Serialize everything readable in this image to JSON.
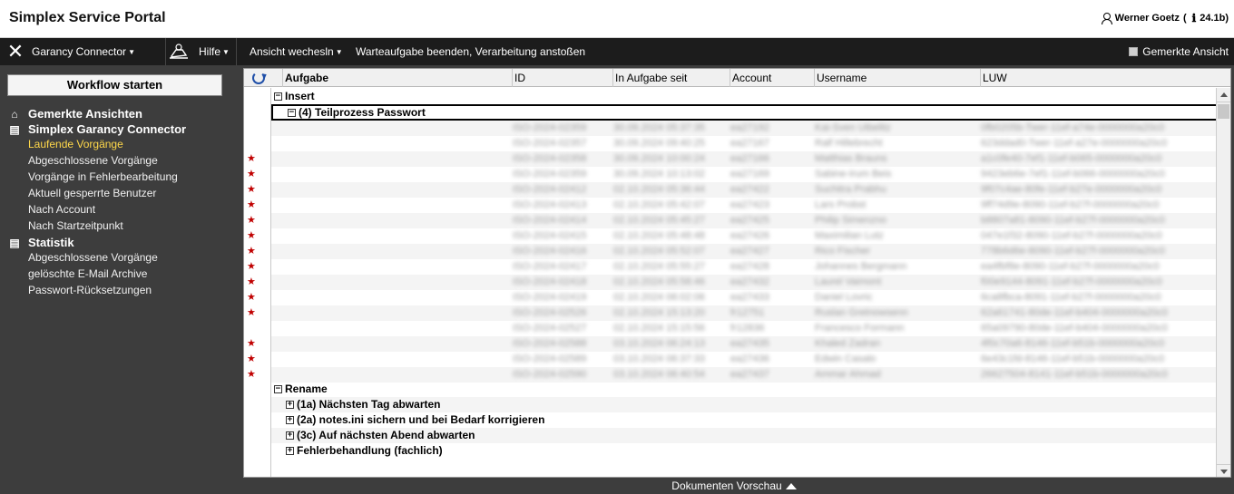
{
  "app": {
    "title": "Simplex Service Portal",
    "user": "Werner Goetz",
    "user_suffix": "(",
    "version": "24.1b)"
  },
  "toolbar": {
    "connector": "Garancy Connector",
    "hilfe": "Hilfe",
    "ansicht": "Ansicht wechesln",
    "warteaufgabe": "Warteaufgabe beenden, Verarbeitung anstoßen",
    "gemerkte_ansicht": "Gemerkte Ansicht"
  },
  "sidebar": {
    "workflow_button": "Workflow starten",
    "section_gemerkte": "Gemerkte Ansichten",
    "section_connector": "Simplex Garancy Connector",
    "connector_items": [
      "Laufende Vorgänge",
      "Abgeschlossene Vorgänge",
      "Vorgänge in Fehlerbearbeitung",
      "Aktuell gesperrte Benutzer",
      "Nach Account",
      "Nach Startzeitpunkt"
    ],
    "section_statistik": "Statistik",
    "statistik_items": [
      "Abgeschlossene Vorgänge",
      "gelöschte E-Mail Archive",
      "Passwort-Rücksetzungen"
    ]
  },
  "grid": {
    "columns": [
      "Aufgabe",
      "ID",
      "In Aufgabe seit",
      "Account",
      "Username",
      "LUW"
    ],
    "groups": {
      "insert": "Insert",
      "teilprozess": "(4) Teilprozess Passwort",
      "rename": "Rename",
      "rename_children": [
        "(1a) Nächsten Tag abwarten",
        "(2a) notes.ini sichern und bei Bedarf korrigieren",
        "(3c) Auf nächsten Abend abwarten",
        "Fehlerbehandlung (fachlich)"
      ]
    },
    "rows": [
      {
        "id": "ISO-2024-02359",
        "since": "30.09.2024 05:37:35",
        "account": "ea27192",
        "username": "Kai-Sven Uibelitz",
        "luw": "0fb0205b-Twer-11ef-a74e-0000000a20c0",
        "star": false
      },
      {
        "id": "ISO-2024-02357",
        "since": "30.09.2024 09:40:25",
        "account": "ea27167",
        "username": "Ralf Hillebrecht",
        "luw": "623ddad0-Twer-11ef-a27e-0000000a20c0",
        "star": false
      },
      {
        "id": "ISO-2024-02358",
        "since": "30.09.2024 10:00:24",
        "account": "ea27166",
        "username": "Matthias Brauns",
        "luw": "a1c0fe40-7ef1-11ef-b065-0000000a20c0",
        "star": true
      },
      {
        "id": "ISO-2024-02359",
        "since": "30.09.2024 10:13:02",
        "account": "ea27169",
        "username": "Sabine-Irum Beis",
        "luw": "9423eb6e-7ef1-11ef-b066-0000000a20c0",
        "star": true
      },
      {
        "id": "ISO-2024-02412",
        "since": "02.10.2024 05:36:44",
        "account": "ea27422",
        "username": "Suchitra Prabhu",
        "luw": "9f07c4ae-80fe-11ef-b27e-0000000a20c0",
        "star": true
      },
      {
        "id": "ISO-2024-02413",
        "since": "02.10.2024 05:42:07",
        "account": "ea27423",
        "username": "Lars Probst",
        "luw": "9ff74d9e-8090-11ef-b27f-0000000a20c0",
        "star": true
      },
      {
        "id": "ISO-2024-02414",
        "since": "02.10.2024 05:45:27",
        "account": "ea27425",
        "username": "Philip Simenzno",
        "luw": "b8807a81-8090-11ef-b27f-0000000a20c0",
        "star": true
      },
      {
        "id": "ISO-2024-02415",
        "since": "02.10.2024 05:48:48",
        "account": "ea27426",
        "username": "Maximilian Lutz",
        "luw": "047e1f32-8090-11ef-b27f-0000000a20c0",
        "star": true
      },
      {
        "id": "ISO-2024-02416",
        "since": "02.10.2024 05:52:07",
        "account": "ea27427",
        "username": "Rico Fischer",
        "luw": "778b6d6e-8090-11ef-b27f-0000000a20c0",
        "star": true
      },
      {
        "id": "ISO-2024-02417",
        "since": "02.10.2024 05:55:27",
        "account": "ea27428",
        "username": "Johannes Bergmann",
        "luw": "ea4fbf8e-8090-11ef-b27f-0000000a20c0",
        "star": true
      },
      {
        "id": "ISO-2024-02418",
        "since": "02.10.2024 05:58:46",
        "account": "ea27432",
        "username": "Laurel Vaimont",
        "luw": "f00e9144-8091-11ef-b27f-0000000a20c0",
        "star": true
      },
      {
        "id": "ISO-2024-02419",
        "since": "02.10.2024 06:02:06",
        "account": "ea27433",
        "username": "Daniel Lovric",
        "luw": "6ca8fbca-8091-11ef-b27f-0000000a20c0",
        "star": true
      },
      {
        "id": "ISO-2024-02526",
        "since": "02.10.2024 15:13:20",
        "account": "fr12751",
        "username": "Ruslan Gretnowsenn",
        "luw": "62a61741-80de-11ef-b404-0000000a20c0",
        "star": true
      },
      {
        "id": "ISO-2024-02527",
        "since": "02.10.2024 15:15:56",
        "account": "fr12836",
        "username": "Francesco Formann",
        "luw": "65a09790-80de-11ef-b404-0000000a20c0",
        "star": false
      },
      {
        "id": "ISO-2024-02588",
        "since": "03.10.2024 06:24:13",
        "account": "ea27435",
        "username": "Khaled Zadran",
        "luw": "4f0c70a6-8146-11ef-b51b-0000000a20c0",
        "star": true
      },
      {
        "id": "ISO-2024-02589",
        "since": "03.10.2024 06:37:33",
        "account": "ea27436",
        "username": "Edwin Casalo",
        "luw": "6e43c1fd-8146-11ef-b51b-0000000a20c0",
        "star": true
      },
      {
        "id": "ISO-2024-02590",
        "since": "03.10.2024 06:40:54",
        "account": "ea27437",
        "username": "Ammar Ahmad",
        "luw": "26627504-8141-11ef-b51b-0000000a20c0",
        "star": true
      }
    ]
  },
  "footer": {
    "preview": "Dokumenten Vorschau"
  }
}
